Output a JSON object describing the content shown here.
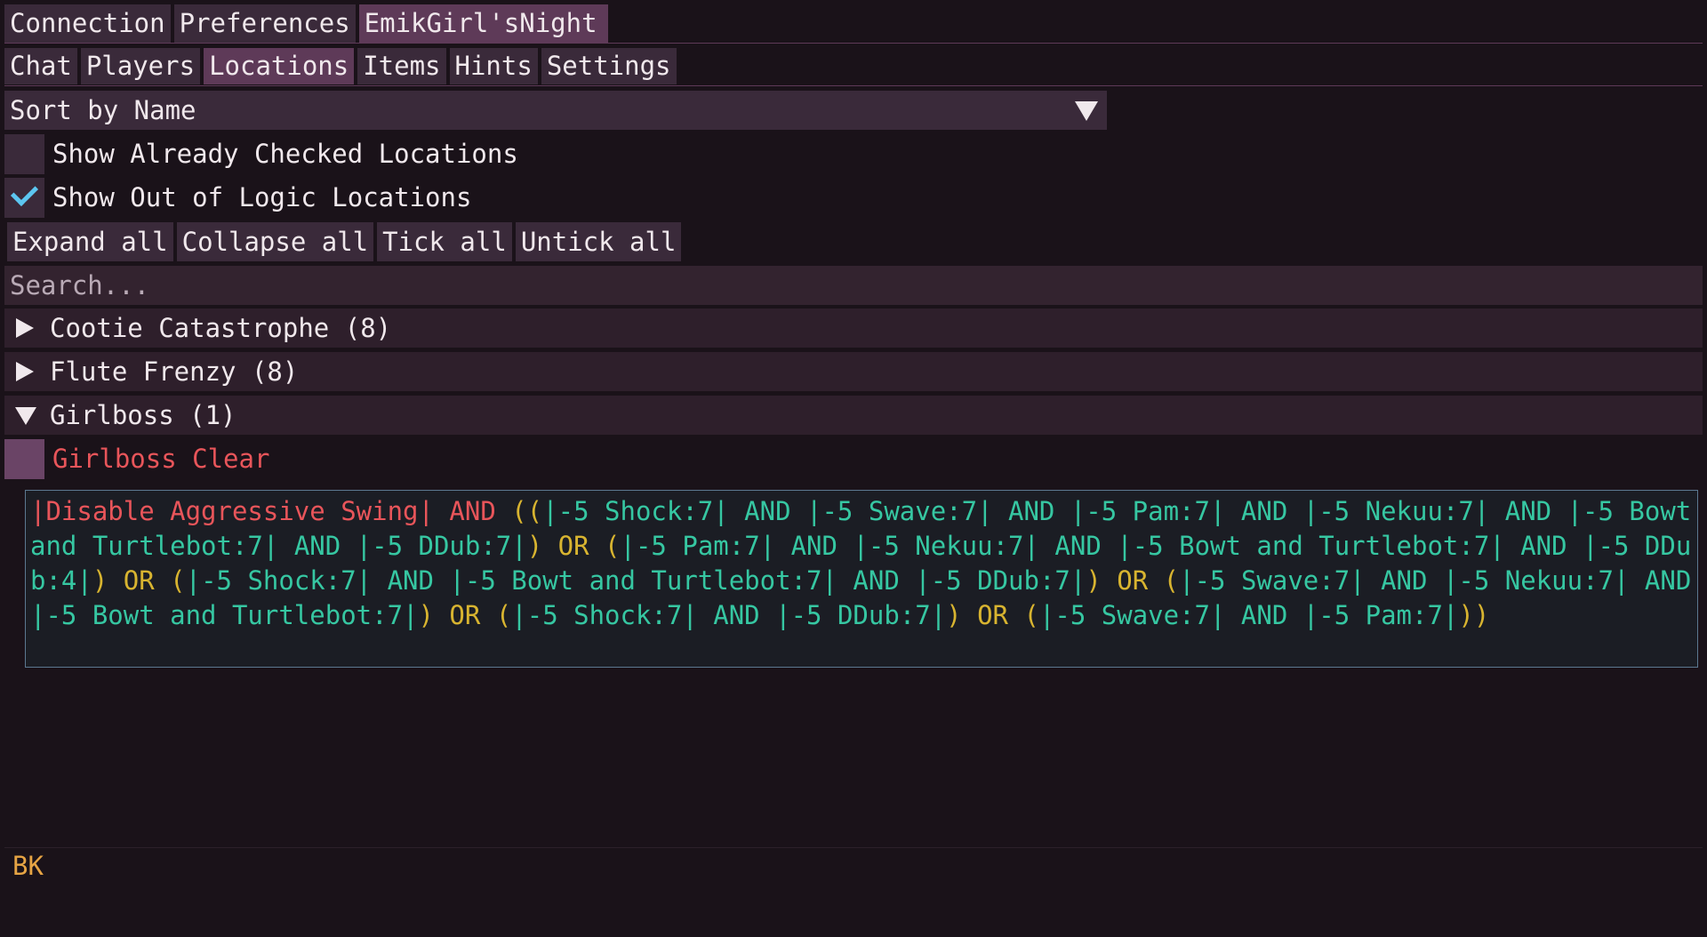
{
  "main_tabs": [
    {
      "label": "Connection",
      "active": false
    },
    {
      "label": "Preferences",
      "active": false
    },
    {
      "label": "EmikGirl'sNight",
      "active": true
    }
  ],
  "sub_tabs": [
    {
      "label": "Chat",
      "active": false
    },
    {
      "label": "Players",
      "active": false
    },
    {
      "label": "Locations",
      "active": true
    },
    {
      "label": "Items",
      "active": false
    },
    {
      "label": "Hints",
      "active": false
    },
    {
      "label": "Settings",
      "active": false
    }
  ],
  "sort": {
    "selected": "Sort by Name",
    "icon": "dropdown-triangle-icon"
  },
  "filters": {
    "show_checked": {
      "label": "Show Already Checked Locations",
      "checked": false
    },
    "show_out_of_logic": {
      "label": "Show Out of Logic Locations",
      "checked": true
    }
  },
  "actions": {
    "expand_all": "Expand all",
    "collapse_all": "Collapse all",
    "tick_all": "Tick all",
    "untick_all": "Untick all"
  },
  "search": {
    "placeholder": "Search...",
    "value": ""
  },
  "groups": [
    {
      "label": "Cootie Catastrophe (8)",
      "expanded": false
    },
    {
      "label": "Flute Frenzy (8)",
      "expanded": false
    },
    {
      "label": "Girlboss (1)",
      "expanded": true
    }
  ],
  "location": {
    "label": "Girlboss Clear",
    "checked": false
  },
  "logic_segments": [
    {
      "t": "|Disable Aggressive Swing|",
      "c": "red"
    },
    {
      "t": " AND ",
      "c": "op"
    },
    {
      "t": "((",
      "c": "paren"
    },
    {
      "t": "|-5 Shock:7|",
      "c": "green"
    },
    {
      "t": " AND ",
      "c": "green"
    },
    {
      "t": "|-5 Swave:7|",
      "c": "green"
    },
    {
      "t": " AND ",
      "c": "green"
    },
    {
      "t": "|-5 Pam:7|",
      "c": "green"
    },
    {
      "t": " AND ",
      "c": "green"
    },
    {
      "t": "|-5 Nekuu:7|",
      "c": "green"
    },
    {
      "t": " AND ",
      "c": "green"
    },
    {
      "t": "|-5 Bowt and Turtlebot:7|",
      "c": "green"
    },
    {
      "t": " AND ",
      "c": "green"
    },
    {
      "t": "|-5 DDub:7|",
      "c": "green"
    },
    {
      "t": ")",
      "c": "paren"
    },
    {
      "t": " OR ",
      "c": "or"
    },
    {
      "t": "(",
      "c": "paren"
    },
    {
      "t": "|-5 Pam:7|",
      "c": "green"
    },
    {
      "t": " AND ",
      "c": "green"
    },
    {
      "t": "|-5 Nekuu:7|",
      "c": "green"
    },
    {
      "t": " AND ",
      "c": "green"
    },
    {
      "t": "|-5 Bowt and Turtlebot:7|",
      "c": "green"
    },
    {
      "t": " AND ",
      "c": "green"
    },
    {
      "t": "|-5 DDub:4|",
      "c": "green"
    },
    {
      "t": ")",
      "c": "paren"
    },
    {
      "t": " OR ",
      "c": "or"
    },
    {
      "t": "(",
      "c": "paren"
    },
    {
      "t": "|-5 Shock:7|",
      "c": "green"
    },
    {
      "t": " AND ",
      "c": "green"
    },
    {
      "t": "|-5 Bowt and Turtlebot:7|",
      "c": "green"
    },
    {
      "t": " AND ",
      "c": "green"
    },
    {
      "t": "|-5 DDub:7|",
      "c": "green"
    },
    {
      "t": ")",
      "c": "paren"
    },
    {
      "t": " OR ",
      "c": "or"
    },
    {
      "t": "(",
      "c": "paren"
    },
    {
      "t": "|-5 Swave:7|",
      "c": "green"
    },
    {
      "t": " AND ",
      "c": "green"
    },
    {
      "t": "|-5 Nekuu:7|",
      "c": "green"
    },
    {
      "t": " AND ",
      "c": "green"
    },
    {
      "t": "|-5 Bowt and Turtlebot:7|",
      "c": "green"
    },
    {
      "t": ")",
      "c": "paren"
    },
    {
      "t": " OR ",
      "c": "or"
    },
    {
      "t": "(",
      "c": "paren"
    },
    {
      "t": "|-5 Shock:7|",
      "c": "green"
    },
    {
      "t": " AND ",
      "c": "green"
    },
    {
      "t": "|-5 DDub:7|",
      "c": "green"
    },
    {
      "t": ")",
      "c": "paren"
    },
    {
      "t": " OR ",
      "c": "or"
    },
    {
      "t": "(",
      "c": "paren"
    },
    {
      "t": "|-5 Swave:7|",
      "c": "green"
    },
    {
      "t": " AND ",
      "c": "green"
    },
    {
      "t": "|-5 Pam:7|",
      "c": "green"
    },
    {
      "t": "))",
      "c": "paren"
    }
  ],
  "status": {
    "text": "BK"
  },
  "colors": {
    "background": "#1a1219",
    "tab": "#3a2a3a",
    "tab_active": "#5e3a58",
    "checkmark": "#5cc6f0",
    "logic_red": "#e8555a",
    "logic_green": "#36c7a2",
    "logic_yellow": "#d8b430",
    "status": "#e6a444"
  }
}
